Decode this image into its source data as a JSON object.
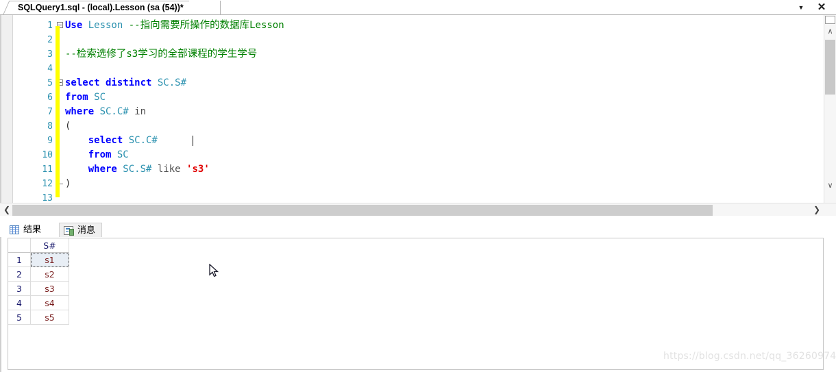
{
  "window": {
    "tab_title": "SQLQuery1.sql - (local).Lesson (sa (54))*",
    "dropdown_glyph": "▼",
    "close_glyph": "✕"
  },
  "editor": {
    "lines": [
      {
        "number": "1",
        "fold": "open",
        "tokens": [
          {
            "text": "Use ",
            "cls": "kw"
          },
          {
            "text": "Lesson ",
            "cls": "id"
          },
          {
            "text": "--",
            "cls": "cm"
          },
          {
            "text": "指向需要所操作的数据库",
            "cls": "cm cjk"
          },
          {
            "text": "Lesson",
            "cls": "cm"
          }
        ]
      },
      {
        "number": "2",
        "fold": "none",
        "tokens": []
      },
      {
        "number": "3",
        "fold": "tick",
        "tokens": [
          {
            "text": "--",
            "cls": "cm"
          },
          {
            "text": "检索选修了",
            "cls": "cm cjk"
          },
          {
            "text": "s3",
            "cls": "cm"
          },
          {
            "text": "学习的全部课程的学生学号",
            "cls": "cm cjk"
          }
        ]
      },
      {
        "number": "4",
        "fold": "none",
        "tokens": []
      },
      {
        "number": "5",
        "fold": "open",
        "tokens": [
          {
            "text": "select distinct ",
            "cls": "kw"
          },
          {
            "text": "SC.S#",
            "cls": "id"
          }
        ]
      },
      {
        "number": "6",
        "fold": "none",
        "tokens": [
          {
            "text": "from ",
            "cls": "kw"
          },
          {
            "text": "SC",
            "cls": "id"
          }
        ]
      },
      {
        "number": "7",
        "fold": "none",
        "tokens": [
          {
            "text": "where ",
            "cls": "kw"
          },
          {
            "text": "SC.C# ",
            "cls": "id"
          },
          {
            "text": "in",
            "cls": "op"
          }
        ]
      },
      {
        "number": "8",
        "fold": "none",
        "tokens": [
          {
            "text": "(",
            "cls": "pn"
          }
        ]
      },
      {
        "number": "9",
        "fold": "none",
        "tokens": [
          {
            "text": "    select ",
            "cls": "kw"
          },
          {
            "text": "SC.C#",
            "cls": "id"
          }
        ]
      },
      {
        "number": "10",
        "fold": "none",
        "tokens": [
          {
            "text": "    from ",
            "cls": "kw"
          },
          {
            "text": "SC",
            "cls": "id"
          }
        ]
      },
      {
        "number": "11",
        "fold": "none",
        "tokens": [
          {
            "text": "    where ",
            "cls": "kw"
          },
          {
            "text": "SC.S# ",
            "cls": "id"
          },
          {
            "text": "like ",
            "cls": "op"
          },
          {
            "text": "'s3'",
            "cls": "st"
          }
        ]
      },
      {
        "number": "12",
        "fold": "close",
        "tokens": [
          {
            "text": ")",
            "cls": "pn"
          }
        ]
      },
      {
        "number": "13",
        "fold": "none",
        "tokens": []
      }
    ]
  },
  "results": {
    "tabs": [
      {
        "label": "结果",
        "icon": "grid-icon",
        "active": true
      },
      {
        "label": "消息",
        "icon": "document-icon",
        "active": false
      }
    ],
    "grid": {
      "columns": [
        "",
        "S#"
      ],
      "rows": [
        {
          "num": "1",
          "value": "s1"
        },
        {
          "num": "2",
          "value": "s2"
        },
        {
          "num": "3",
          "value": "s3"
        },
        {
          "num": "4",
          "value": "s4"
        },
        {
          "num": "5",
          "value": "s5"
        }
      ],
      "selected_cell": "s1"
    }
  },
  "scrollbars": {
    "vertical_up": "∧",
    "vertical_down": "∨",
    "horizontal_left": "❮",
    "horizontal_right": "❯"
  },
  "watermark": "https://blog.csdn.net/qq_36260974"
}
